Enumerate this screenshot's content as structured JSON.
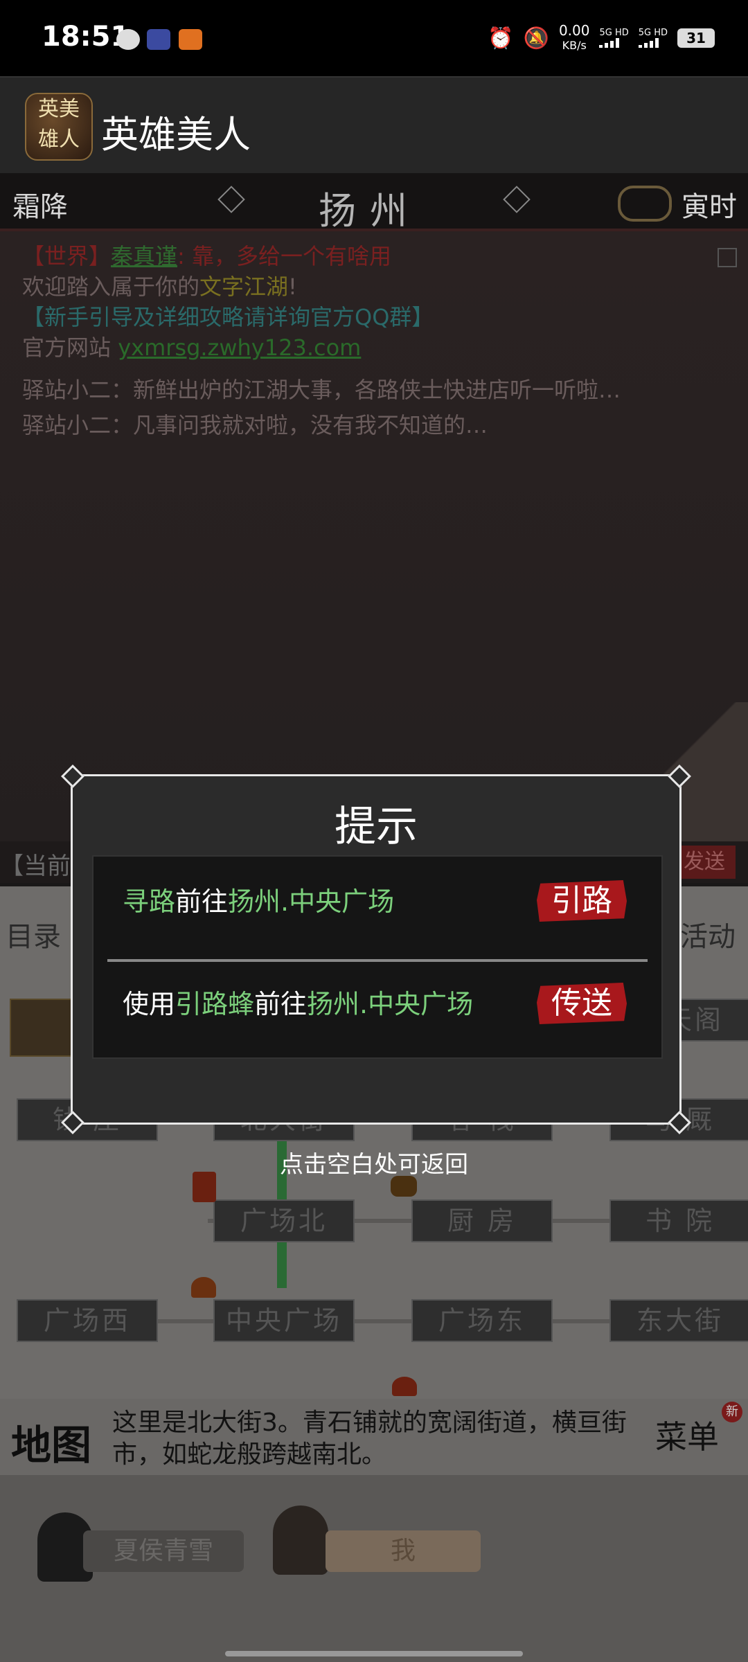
{
  "status_bar": {
    "time": "18:51",
    "net_speed": "0.00",
    "net_unit": "KB/s",
    "sim1": "5G HD",
    "sim2": "5G HD",
    "battery": "31",
    "icons": [
      "wechat-icon",
      "shield-app-icon",
      "game-app-icon",
      "alarm-icon",
      "mute-icon"
    ]
  },
  "app": {
    "title": "英雄美人",
    "icon_text": [
      "英",
      "美",
      "雄",
      "人"
    ]
  },
  "header": {
    "season": "霜降",
    "city": "扬州",
    "time_of_day": "寅时"
  },
  "chat": {
    "world_tag": "【世界】",
    "world_user": "秦真谨",
    "world_msg": ": 靠，多给一个有啥用",
    "welcome_prefix": "欢迎踏入属于你的",
    "welcome_highlight": "文字江湖",
    "welcome_suffix": "!",
    "guide": "【新手引导及详细攻略请详询官方QQ群】",
    "site_label": "官方网站 ",
    "site_url": "yxmrsg.zwhy123.com",
    "npc1": "驿站小二：新鲜出炉的江湖大事，各路侠士快进店听一听啦…",
    "npc2": "驿站小二：凡事问我就对啦，没有我不知道的…"
  },
  "channel": {
    "label": "【当前】",
    "send": "发送"
  },
  "map": {
    "tab_left": "目录",
    "tab_right": "活动",
    "nodes": {
      "tongtian": "通天阁",
      "qianzhuang": "钱 庄",
      "beidajie": "北大街",
      "kezhan": "客 栈",
      "majiu": "马 厩",
      "guangchangbei": "广场北",
      "chufang": "厨 房",
      "shuyuan": "书 院",
      "guangchangxi": "广场西",
      "zhongyang": "中央广场",
      "guangchangdong": "广场东",
      "dongdajie": "东大街"
    }
  },
  "description": {
    "map_label": "地图",
    "text": "这里是北大街3。青石铺就的宽阔街道，横亘街市，如蛇龙般跨越南北。",
    "event_label": "菜单",
    "new_badge": "新"
  },
  "characters": {
    "npc_name": "夏侯青雪",
    "self_name": "我"
  },
  "dialog": {
    "title": "提示",
    "option1": {
      "verb": "寻路",
      "mid": "前往",
      "dest": "扬州.中央广场",
      "button": "引路"
    },
    "option2": {
      "pre": "使用",
      "item": "引路蜂",
      "mid": "前往",
      "dest": "扬州.中央广场",
      "button": "传送"
    },
    "dismiss_hint": "点击空白处可返回"
  },
  "colors": {
    "accent_green": "#7cd07c",
    "button_red": "#a8181c",
    "dialog_bg": "#2b2b2b"
  }
}
